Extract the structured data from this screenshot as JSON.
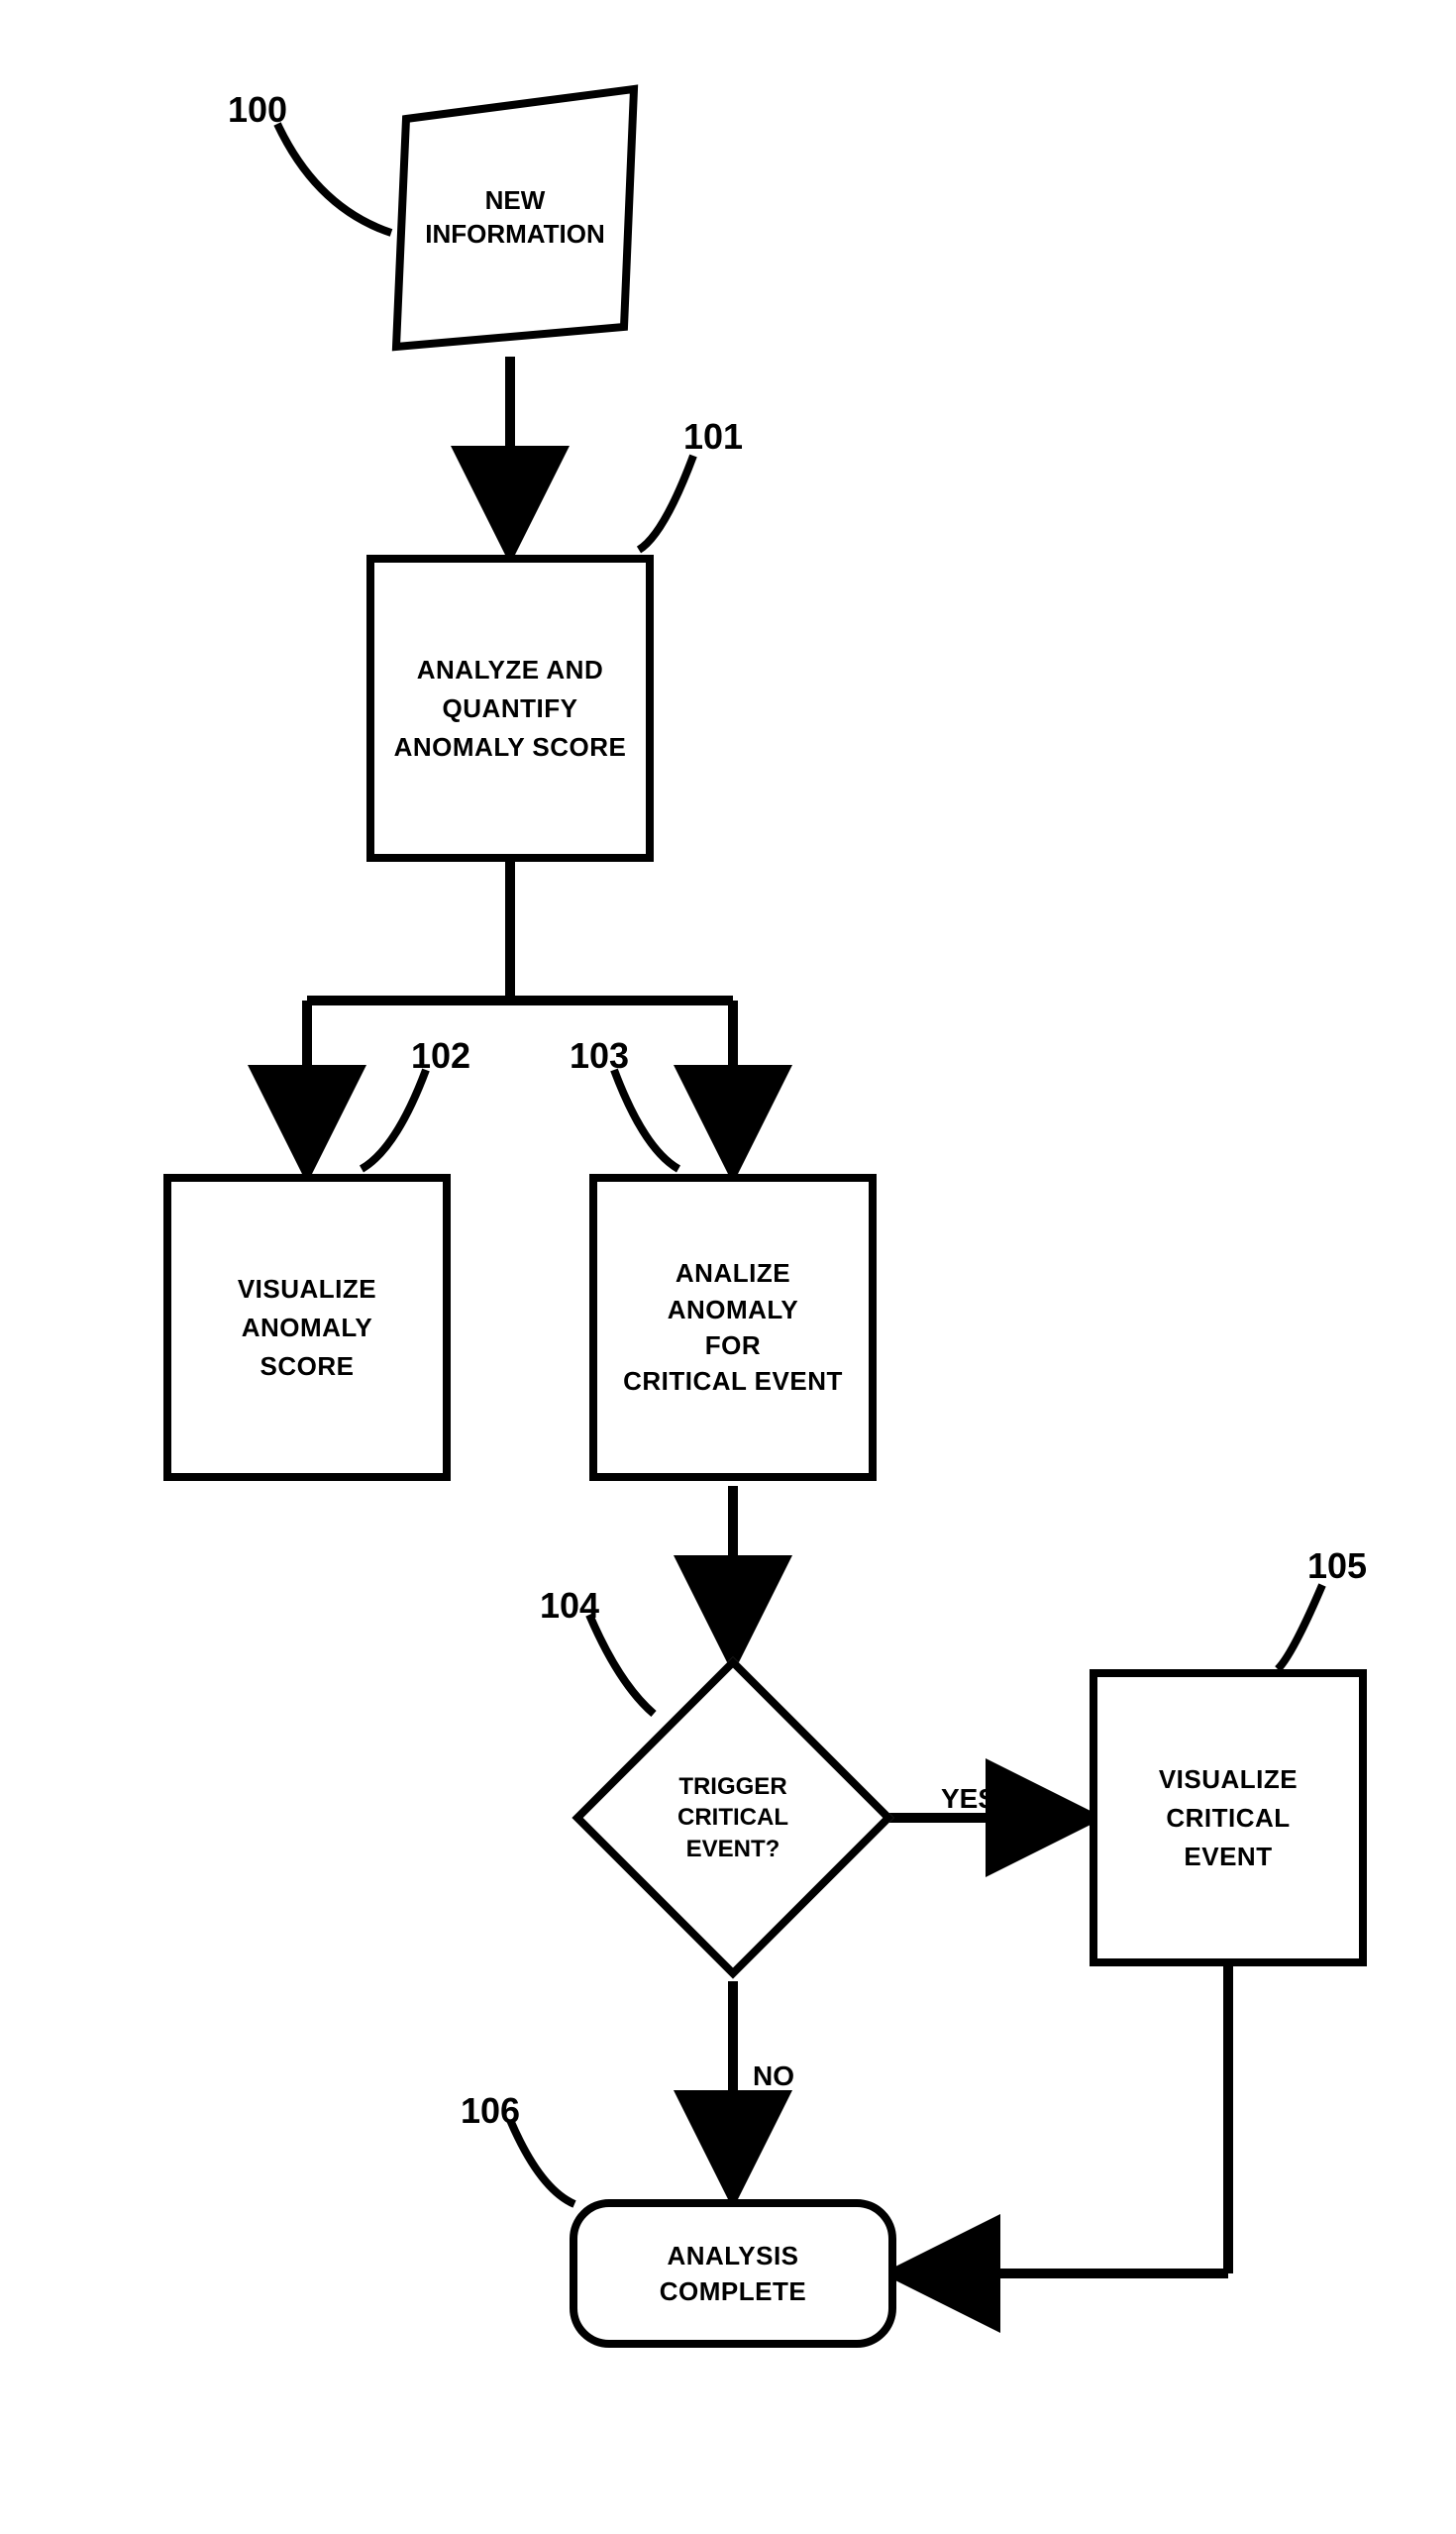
{
  "nodes": {
    "new_info": {
      "text": "NEW\nINFORMATION"
    },
    "analyze_quantify": {
      "text": "ANALYZE AND\nQUANTIFY\nANOMALY SCORE"
    },
    "visualize_score": {
      "text": "VISUALIZE\nANOMALY\nSCORE"
    },
    "analyze_critical": {
      "text": "ANALIZE\nANOMALY\nFOR\nCRITICAL EVENT"
    },
    "trigger": {
      "text": "TRIGGER\nCRITICAL\nEVENT?"
    },
    "visualize_critical": {
      "text": "VISUALIZE\nCRITICAL\nEVENT"
    },
    "complete": {
      "text": "ANALYSIS\nCOMPLETE"
    }
  },
  "edges": {
    "yes": "YES",
    "no": "NO"
  },
  "callouts": {
    "n100": "100",
    "n101": "101",
    "n102": "102",
    "n103": "103",
    "n104": "104",
    "n105": "105",
    "n106": "106"
  }
}
